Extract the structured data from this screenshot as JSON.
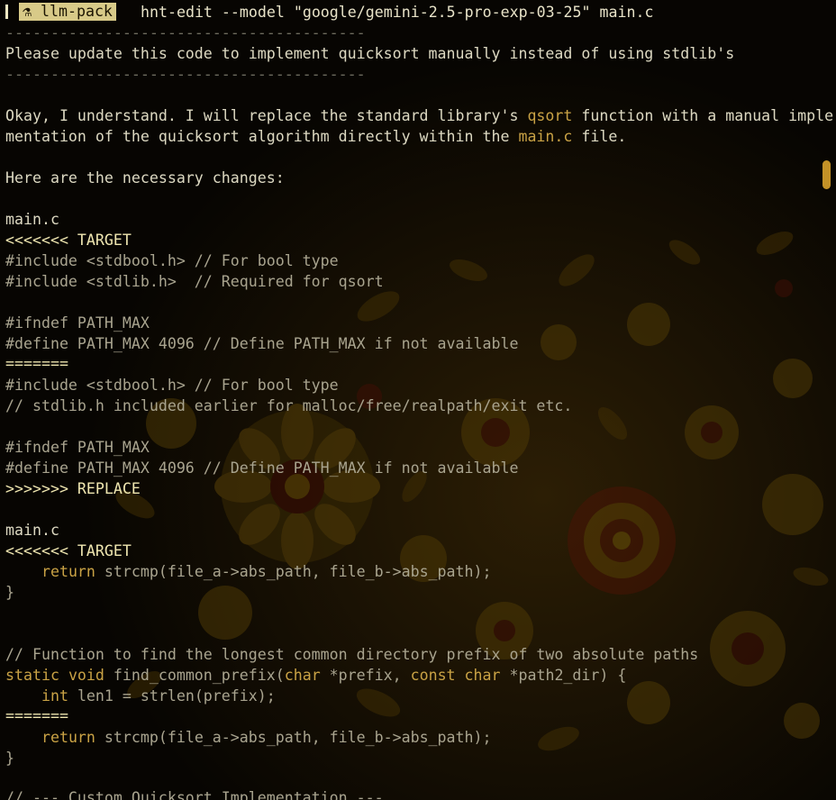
{
  "window": {
    "tag_label": "llm-pack",
    "command": "hnt-edit --model \"google/gemini-2.5-pro-exp-03-25\" main.c"
  },
  "colors": {
    "background": "#070502",
    "accent_gold": "#c9a245",
    "text": "#ddd9c2",
    "code_dim": "#a9a48f",
    "scrollbar": "#c49227"
  },
  "icons": {
    "tag_icon": "flask-icon"
  },
  "conversation": {
    "separator": "----------------------------------------",
    "user_prompt": "Please update this code to implement quicksort manually instead of using stdlib's",
    "reply_line1_a": "Okay, I understand. I will replace the standard library's ",
    "reply_line1_hl": "qsort",
    "reply_line1_b": " function with a manual imple",
    "reply_line2_a": "mentation of the quicksort algorithm directly within the ",
    "reply_line2_hl": "main.c",
    "reply_line2_b": " file.",
    "changes_intro": "Here are the necessary changes:"
  },
  "block1": {
    "filename": "main.c",
    "target_marker": "<<<<<<< TARGET",
    "target_lines": [
      "#include <stdbool.h> // For bool type",
      "#include <stdlib.h>  // Required for qsort",
      "",
      "#ifndef PATH_MAX",
      "#define PATH_MAX 4096 // Define PATH_MAX if not available"
    ],
    "divider": "=======",
    "replace_lines": [
      "#include <stdbool.h> // For bool type",
      "// stdlib.h included earlier for malloc/free/realpath/exit etc.",
      "",
      "#ifndef PATH_MAX",
      "#define PATH_MAX 4096 // Define PATH_MAX if not available"
    ],
    "replace_marker": ">>>>>>> REPLACE"
  },
  "block2": {
    "filename": "main.c",
    "target_marker": "<<<<<<< TARGET",
    "ret_indent": "    ",
    "ret_kw": "return",
    "ret_rest": " strcmp(file_a->abs_path, file_b->abs_path);",
    "close_brace": "}",
    "comment": "// Function to find the longest common directory prefix of two absolute paths",
    "sig_static": "static",
    "sig_void": " void",
    "sig_name": " find_common_prefix(",
    "sig_char1": "char",
    "sig_p1": " *prefix, ",
    "sig_const": "const",
    "sig_char2": " char",
    "sig_p2": " *path2_dir) {",
    "decl_indent": "    ",
    "decl_int": "int",
    "decl_rest": " len1 = strlen(prefix);",
    "divider": "=======",
    "ret2_kw": "return",
    "ret2_rest": " strcmp(file_a->abs_path, file_b->abs_path);",
    "close_brace2": "}",
    "partial_comment": "// --- Custom Quicksort Implementation ---"
  }
}
